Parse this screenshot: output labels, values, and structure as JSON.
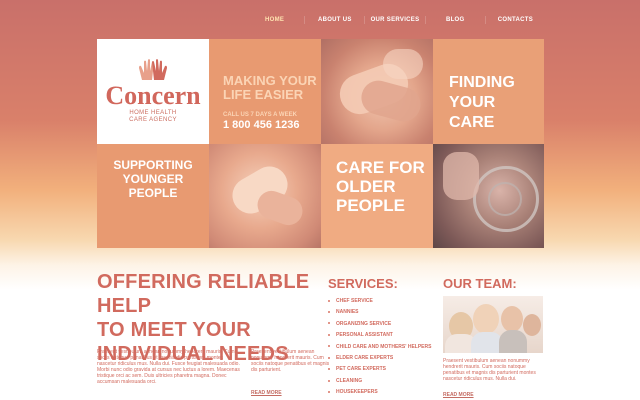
{
  "nav": {
    "items": [
      {
        "label": "HOME",
        "active": true
      },
      {
        "label": "ABOUT US"
      },
      {
        "label": "OUR SERVICES"
      },
      {
        "label": "BLOG"
      },
      {
        "label": "CONTACTS"
      }
    ]
  },
  "logo": {
    "title": "Concern",
    "subtitle_line1": "HOME HEALTH",
    "subtitle_line2": "CARE AGENCY"
  },
  "banner": {
    "easier_line1": "MAKING YOUR",
    "easier_line2": "LIFE EASIER",
    "call_label": "CALL US 7 DAYS A WEEK",
    "phone": "1 800 456 1236",
    "finding_line1": "FINDING",
    "finding_line2": "YOUR",
    "finding_line3": "CARE",
    "supporting_line1": "SUPPORTING",
    "supporting_line2": "YOUNGER",
    "supporting_line3": "PEOPLE",
    "older_line1": "CARE FOR",
    "older_line2": "OLDER",
    "older_line3": "PEOPLE"
  },
  "offer": {
    "title_line1": "OFFERING RELIABLE HELP",
    "title_line2": "TO MEET YOUR",
    "title_line3": "INDIVIDUAL NEEDS",
    "para1": "Praesent vestibulum aenean nonummy hendrerit mauris. Cum sociis natoque penatibus et magnis dis parturient montes nascetur ridiculus mus. Nulla dui. Fusce feugiat malesuada odio. Morbi nunc odio gravida at cursus nec luctus a lorem. Maecenas tristique orci ac sem. Duis ultricies pharetra magna. Donec accumsan malesuada orci.",
    "para2": "Praesent vestibulum aenean nonummy hendrerit mauris. Cum sociis natoque penatibus et magnis dis parturient.",
    "read_more": "READ MORE"
  },
  "services": {
    "title": "SERVICES:",
    "items": [
      "CHEF SERVICE",
      "NANNIES",
      "ORGANIZING SERVICE",
      "PERSONAL ASSISTANT",
      "CHILD CARE AND MOTHERS' HELPERS",
      "ELDER CARE EXPERTS",
      "PET CARE EXPERTS",
      "CLEANING",
      "HOUSEKEEPERS"
    ]
  },
  "team": {
    "title": "OUR TEAM:",
    "para": "Praesent vestibulum aenean nonummy hendrerit mauris. Cum sociis natoque penatibus et magnis dis parturient montes nascetur ridiculus mus. Nulla dui.",
    "read_more": "READ MORE"
  },
  "colors": {
    "accent": "#d16a5e",
    "tile_tan": "#e89a71",
    "nav_active": "#ffe3b0"
  }
}
